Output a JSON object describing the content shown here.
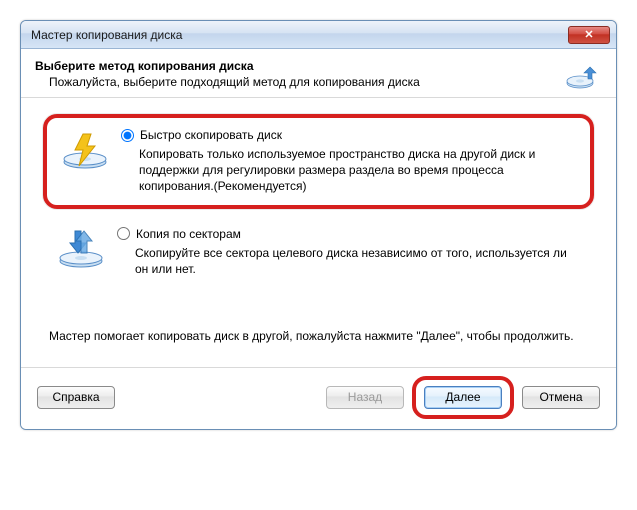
{
  "titlebar": {
    "title": "Мастер копирования диска"
  },
  "header": {
    "title": "Выберите метод копирования диска",
    "subtitle": "Пожалуйста, выберите подходящий метод для копирования диска"
  },
  "options": {
    "fast": {
      "label": "Быстро скопировать диск",
      "desc": "Копировать только используемое пространство диска на другой диск и поддержки для регулировки размера раздела во время процесса копирования.(Рекомендуется)",
      "checked": true
    },
    "sector": {
      "label": "Копия по секторам",
      "desc": "Скопируйте все сектора целевого диска независимо от того, используется ли он или нет.",
      "checked": false
    }
  },
  "note": "Мастер помогает копировать диск в другой, пожалуйста нажмите \"Далее\", чтобы продолжить.",
  "buttons": {
    "help": "Справка",
    "back": "Назад",
    "next": "Далее",
    "cancel": "Отмена"
  }
}
